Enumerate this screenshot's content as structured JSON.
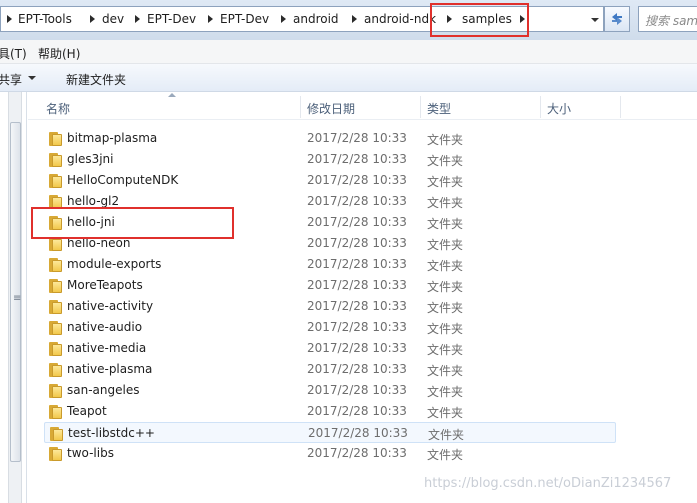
{
  "address_bar": {
    "breadcrumbs": [
      "EPT-Tools",
      "dev",
      "EPT-Dev",
      "EPT-Dev",
      "android",
      "android-ndk",
      "samples"
    ]
  },
  "search": {
    "placeholder": "搜索 samples"
  },
  "menu": {
    "items": [
      "具(T)",
      "帮助(H)"
    ]
  },
  "toolbar": {
    "share_label": "共享",
    "new_folder_label": "新建文件夹"
  },
  "columns": {
    "name": "名称",
    "date": "修改日期",
    "type": "类型",
    "size": "大小"
  },
  "files": [
    {
      "name": "bitmap-plasma",
      "date": "2017/2/28 10:33",
      "type": "文件夹"
    },
    {
      "name": "gles3jni",
      "date": "2017/2/28 10:33",
      "type": "文件夹"
    },
    {
      "name": "HelloComputeNDK",
      "date": "2017/2/28 10:33",
      "type": "文件夹"
    },
    {
      "name": "hello-gl2",
      "date": "2017/2/28 10:33",
      "type": "文件夹"
    },
    {
      "name": "hello-jni",
      "date": "2017/2/28 10:33",
      "type": "文件夹"
    },
    {
      "name": "hello-neon",
      "date": "2017/2/28 10:33",
      "type": "文件夹"
    },
    {
      "name": "module-exports",
      "date": "2017/2/28 10:33",
      "type": "文件夹"
    },
    {
      "name": "MoreTeapots",
      "date": "2017/2/28 10:33",
      "type": "文件夹"
    },
    {
      "name": "native-activity",
      "date": "2017/2/28 10:33",
      "type": "文件夹"
    },
    {
      "name": "native-audio",
      "date": "2017/2/28 10:33",
      "type": "文件夹"
    },
    {
      "name": "native-media",
      "date": "2017/2/28 10:33",
      "type": "文件夹"
    },
    {
      "name": "native-plasma",
      "date": "2017/2/28 10:33",
      "type": "文件夹"
    },
    {
      "name": "san-angeles",
      "date": "2017/2/28 10:33",
      "type": "文件夹"
    },
    {
      "name": "Teapot",
      "date": "2017/2/28 10:33",
      "type": "文件夹"
    },
    {
      "name": "test-libstdc++",
      "date": "2017/2/28 10:33",
      "type": "文件夹"
    },
    {
      "name": "two-libs",
      "date": "2017/2/28 10:33",
      "type": "文件夹"
    }
  ],
  "watermark": "https://blog.csdn.net/oDianZi1234567",
  "colors": {
    "highlight": "#e0302c",
    "folder": "#f2c84b",
    "header_text": "#4c607a"
  }
}
